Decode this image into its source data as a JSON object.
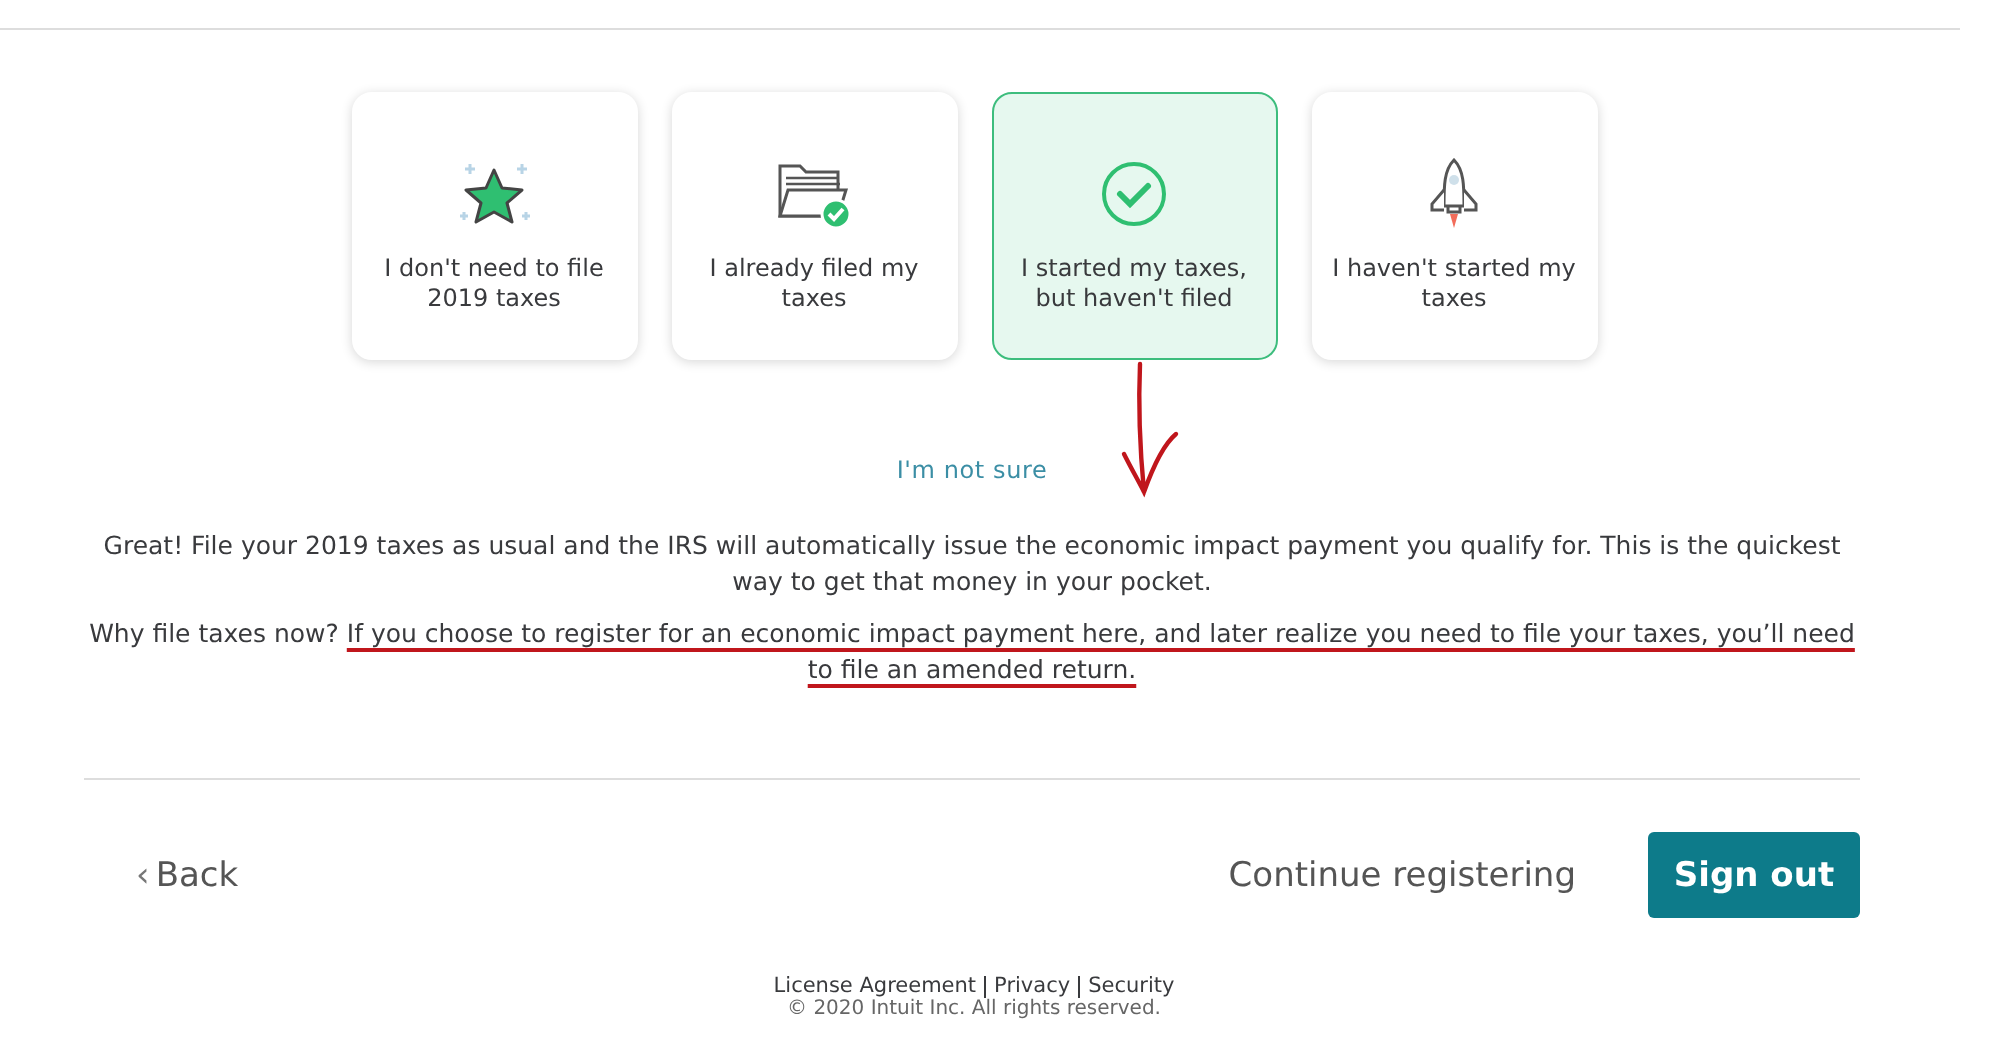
{
  "options": [
    {
      "kind": "star",
      "label": "I don't need to file 2019 taxes",
      "selected": false
    },
    {
      "kind": "folder",
      "label": "I already filed my taxes",
      "selected": false
    },
    {
      "kind": "check",
      "label": "I started my taxes, but haven't filed",
      "selected": true
    },
    {
      "kind": "rocket",
      "label": "I haven't started my taxes",
      "selected": false
    }
  ],
  "not_sure_link": "I'm not sure",
  "message": "Great! File your 2019 taxes as usual and the IRS will automatically issue the economic impact payment you qualify for. This is the quickest way to get that money in your pocket.",
  "why": {
    "lead": "Why file taxes now?",
    "detail": "If you choose to register for an economic impact payment here, and later realize you need to file your taxes, you’ll need to file an amended return.",
    "annotated": true
  },
  "back_button": {
    "icon": "‹",
    "label": "Back"
  },
  "continue_button": "Continue registering",
  "sign_out_button": "Sign out",
  "footer_links": [
    "License Agreement",
    "Privacy",
    "Security"
  ],
  "copyright": "© 2020 Intuit Inc. All rights reserved."
}
